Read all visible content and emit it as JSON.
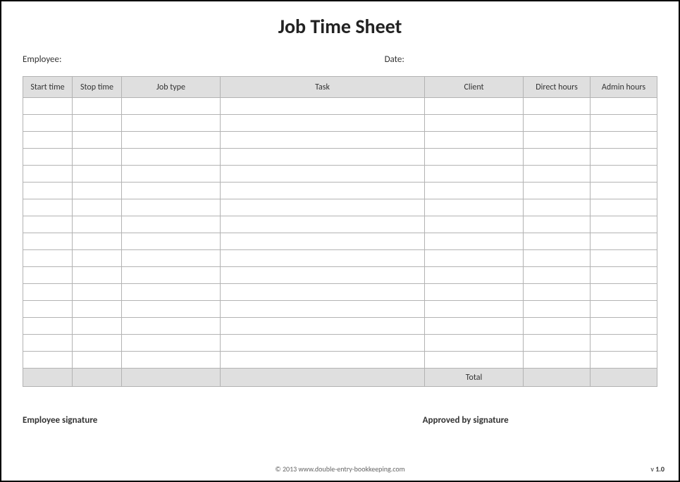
{
  "title": "Job Time Sheet",
  "labels": {
    "employee": "Employee:",
    "date": "Date:",
    "employee_signature": "Employee signature",
    "approved_signature": "Approved by signature"
  },
  "columns": {
    "start_time": "Start time",
    "stop_time": "Stop time",
    "job_type": "Job type",
    "task": "Task",
    "client": "Client",
    "direct_hours": "Direct hours",
    "admin_hours": "Admin hours"
  },
  "rows": [
    {
      "start": "",
      "stop": "",
      "job": "",
      "task": "",
      "client": "",
      "direct": "",
      "admin": ""
    },
    {
      "start": "",
      "stop": "",
      "job": "",
      "task": "",
      "client": "",
      "direct": "",
      "admin": ""
    },
    {
      "start": "",
      "stop": "",
      "job": "",
      "task": "",
      "client": "",
      "direct": "",
      "admin": ""
    },
    {
      "start": "",
      "stop": "",
      "job": "",
      "task": "",
      "client": "",
      "direct": "",
      "admin": ""
    },
    {
      "start": "",
      "stop": "",
      "job": "",
      "task": "",
      "client": "",
      "direct": "",
      "admin": ""
    },
    {
      "start": "",
      "stop": "",
      "job": "",
      "task": "",
      "client": "",
      "direct": "",
      "admin": ""
    },
    {
      "start": "",
      "stop": "",
      "job": "",
      "task": "",
      "client": "",
      "direct": "",
      "admin": ""
    },
    {
      "start": "",
      "stop": "",
      "job": "",
      "task": "",
      "client": "",
      "direct": "",
      "admin": ""
    },
    {
      "start": "",
      "stop": "",
      "job": "",
      "task": "",
      "client": "",
      "direct": "",
      "admin": ""
    },
    {
      "start": "",
      "stop": "",
      "job": "",
      "task": "",
      "client": "",
      "direct": "",
      "admin": ""
    },
    {
      "start": "",
      "stop": "",
      "job": "",
      "task": "",
      "client": "",
      "direct": "",
      "admin": ""
    },
    {
      "start": "",
      "stop": "",
      "job": "",
      "task": "",
      "client": "",
      "direct": "",
      "admin": ""
    },
    {
      "start": "",
      "stop": "",
      "job": "",
      "task": "",
      "client": "",
      "direct": "",
      "admin": ""
    },
    {
      "start": "",
      "stop": "",
      "job": "",
      "task": "",
      "client": "",
      "direct": "",
      "admin": ""
    },
    {
      "start": "",
      "stop": "",
      "job": "",
      "task": "",
      "client": "",
      "direct": "",
      "admin": ""
    },
    {
      "start": "",
      "stop": "",
      "job": "",
      "task": "",
      "client": "",
      "direct": "",
      "admin": ""
    }
  ],
  "total_label": "Total",
  "totals": {
    "direct": "",
    "admin": ""
  },
  "footer": "© 2013 www.double-entry-bookkeeping.com",
  "version_prefix": "v ",
  "version_number": "1.0"
}
